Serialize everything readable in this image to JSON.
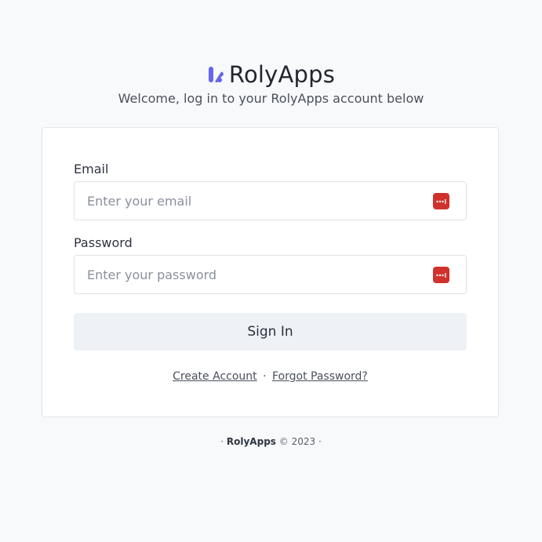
{
  "brand": {
    "name": "RolyApps",
    "accent": "#6366f1",
    "subtitle": "Welcome, log in to your RolyApps account below"
  },
  "form": {
    "email_label": "Email",
    "email_placeholder": "Enter your email",
    "email_value": "",
    "password_label": "Password",
    "password_placeholder": "Enter your password",
    "password_value": "",
    "password_manager_icon": "password-manager-icon",
    "password_manager_color": "#d0312d",
    "sign_in_label": "Sign In"
  },
  "links": {
    "create_account": "Create Account",
    "separator": "·",
    "forgot_password": "Forgot Password?"
  },
  "footer": {
    "prefix": "·",
    "brand": "RolyApps",
    "copyright": "© 2023",
    "suffix": "·"
  }
}
